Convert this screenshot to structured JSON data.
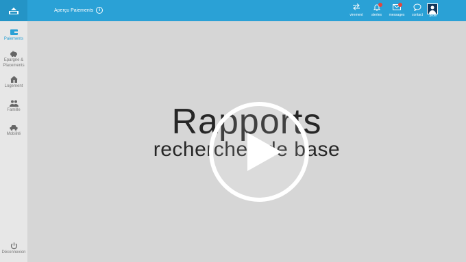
{
  "header": {
    "breadcrumb": "Aperçu Paiements",
    "info_icon": "i",
    "nav": [
      {
        "label": "virement",
        "icon": "transfer-icon"
      },
      {
        "label": "alertes",
        "icon": "bell-icon"
      },
      {
        "label": "messages",
        "icon": "mail-icon"
      },
      {
        "label": "contact",
        "icon": "chat-icon"
      }
    ],
    "profile_label": "profil"
  },
  "sidebar": {
    "items": [
      {
        "label": "Paiements",
        "icon": "wallet-icon"
      },
      {
        "label": "Epargne &",
        "label2": "Placements",
        "icon": "piggy-bank-icon"
      },
      {
        "label": "Logement",
        "icon": "house-icon"
      },
      {
        "label": "Famille",
        "icon": "family-icon"
      },
      {
        "label": "Mobilité",
        "icon": "car-icon"
      }
    ],
    "logout_label": "Déconnexion"
  },
  "video": {
    "title": "Rapports",
    "subtitle": "recherches de base"
  },
  "colors": {
    "topbar": "#2aa1d6",
    "accent": "#2aa1d6",
    "badge": "#e2463d"
  }
}
